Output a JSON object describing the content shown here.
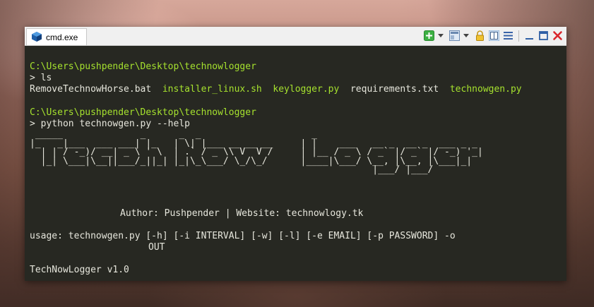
{
  "window": {
    "tab_title": "cmd.exe"
  },
  "icons": {
    "tab": "console-icon",
    "new_tab": "plus-icon",
    "view": "window-view-icon",
    "lock": "lock-icon",
    "split": "split-view-icon",
    "menu": "hamburger-icon",
    "minimize": "minimize-icon",
    "maximize": "maximize-icon",
    "close": "close-icon"
  },
  "colors": {
    "console_bg": "#272822",
    "path": "#a6e22e",
    "text": "#e6e6dc",
    "close": "#d9262c",
    "add": "#3cb043"
  },
  "console": {
    "prompt1_path": "C:\\Users\\pushpender\\Desktop\\technowlogger",
    "cmd1_marker": ">",
    "cmd1": "ls",
    "files": [
      {
        "name": "RemoveTechnowHorse.bat",
        "color": "white"
      },
      {
        "name": "installer_linux.sh",
        "color": "green"
      },
      {
        "name": "keylogger.py",
        "color": "green"
      },
      {
        "name": "requirements.txt",
        "color": "white"
      },
      {
        "name": "technowgen.py",
        "color": "green"
      }
    ],
    "prompt2_path": "C:\\Users\\pushpender\\Desktop\\technowlogger",
    "cmd2_marker": ">",
    "cmd2": "python technowgen.py --help",
    "banner_art": " _____              _      _  _                    _                                \n|_   _|___  ___ ___| |_   | \\| |___ __ __ __     | |    ___   __ _  __ _  ___ _ _ \n  | | / -_)/ __| _ \\ ' \\  | .` / _ \\\\ V  V /     | |__ / _ \\ / _` |/ _` |/ -_) '_|\n  |_| \\___|\\__||___/_||_| |_|\\_\\___/ \\_/\\_/      |____|\\___/ \\__, |\\__, |\\___|_|  \n                                                              |___/ |___/          ",
    "author": "Author: Pushpender | Website: technowlogy.tk",
    "usage1": "usage: technowgen.py [-h] [-i INTERVAL] [-w] [-l] [-e EMAIL] [-p PASSWORD] -o",
    "usage2": "OUT",
    "version": "TechNowLogger v1.0"
  }
}
